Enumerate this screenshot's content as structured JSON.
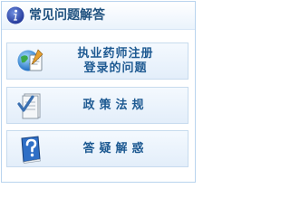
{
  "header": {
    "icon": "info-icon",
    "title": "常见问题解答"
  },
  "items": [
    {
      "icon": "globe-document-icon",
      "line1": "执业药师注册",
      "line2": "登录的问题"
    },
    {
      "icon": "checked-document-icon",
      "line1": "政策法规"
    },
    {
      "icon": "help-book-icon",
      "line1": "答疑解惑"
    }
  ]
}
